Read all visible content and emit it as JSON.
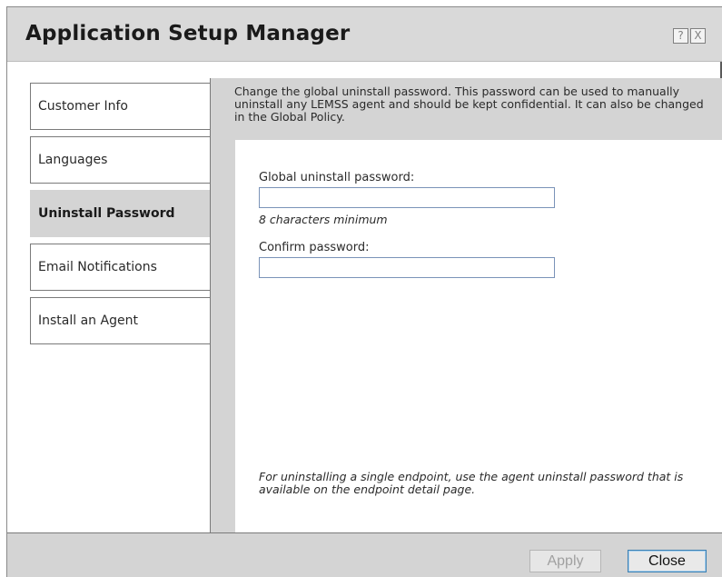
{
  "dialog": {
    "title": "Application Setup Manager",
    "help_icon": "?",
    "close_icon": "X"
  },
  "sidebar": {
    "items": [
      {
        "label": "Customer Info",
        "active": false
      },
      {
        "label": "Languages",
        "active": false
      },
      {
        "label": "Uninstall Password",
        "active": true
      },
      {
        "label": "Email Notifications",
        "active": false
      },
      {
        "label": "Install an Agent",
        "active": false
      }
    ]
  },
  "content": {
    "description": "Change the global uninstall password. This password can be used to manually uninstall any LEMSS agent and should be kept confidential. It can also be changed in the Global Policy.",
    "global_password_label": "Global uninstall password:",
    "global_password_value": "",
    "hint": "8 characters minimum",
    "confirm_password_label": "Confirm password:",
    "confirm_password_value": "",
    "note": "For uninstalling a single endpoint, use the agent uninstall password that is available on the endpoint detail page."
  },
  "footer": {
    "apply_label": "Apply",
    "close_label": "Close"
  }
}
